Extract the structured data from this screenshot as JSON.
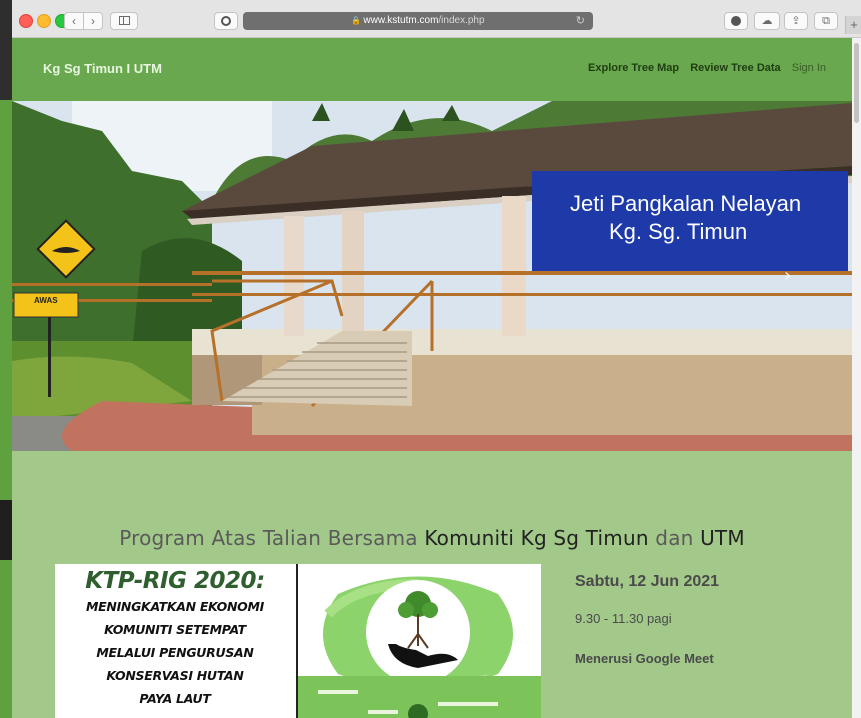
{
  "browser": {
    "url_host": "www.kstutm.com",
    "url_path": "/index.php",
    "lock_icon": "🔒",
    "reload_icon": "↻",
    "back_icon": "‹",
    "forward_icon": "›",
    "cloud_icon": "☁",
    "share_icon": "⇪",
    "tabs_icon": "⧉",
    "plus_icon": "+"
  },
  "navbar": {
    "brand": "Kg Sg Timun I UTM",
    "links": [
      "Explore Tree Map",
      "Review Tree Data",
      "Sign In"
    ]
  },
  "hero": {
    "sign_line1": "Jeti Pangkalan Nelayan",
    "sign_line2": "Kg. Sg. Timun",
    "warning_sign": "AWAS"
  },
  "main": {
    "heading_prefix": "Program Atas Talian Bersama ",
    "heading_bold1": "Komuniti Kg Sg Timun",
    "heading_mid": " dan ",
    "heading_bold2": "UTM"
  },
  "poster": {
    "title": "KTP-RIG 2020:",
    "lines": [
      "MENINGKATKAN EKONOMI",
      "KOMUNITI SETEMPAT",
      "MELALUI PENGURUSAN",
      "KONSERVASI HUTAN",
      "PAYA LAUT"
    ]
  },
  "event": {
    "date": "Sabtu, 12 Jun 2021",
    "time": "9.30 - 11.30 pagi",
    "place": "Menerusi Google Meet"
  },
  "colors": {
    "navbar": "#6aa84f",
    "page_bg": "#a3c98a",
    "sign_blue": "#1d3aa8"
  }
}
